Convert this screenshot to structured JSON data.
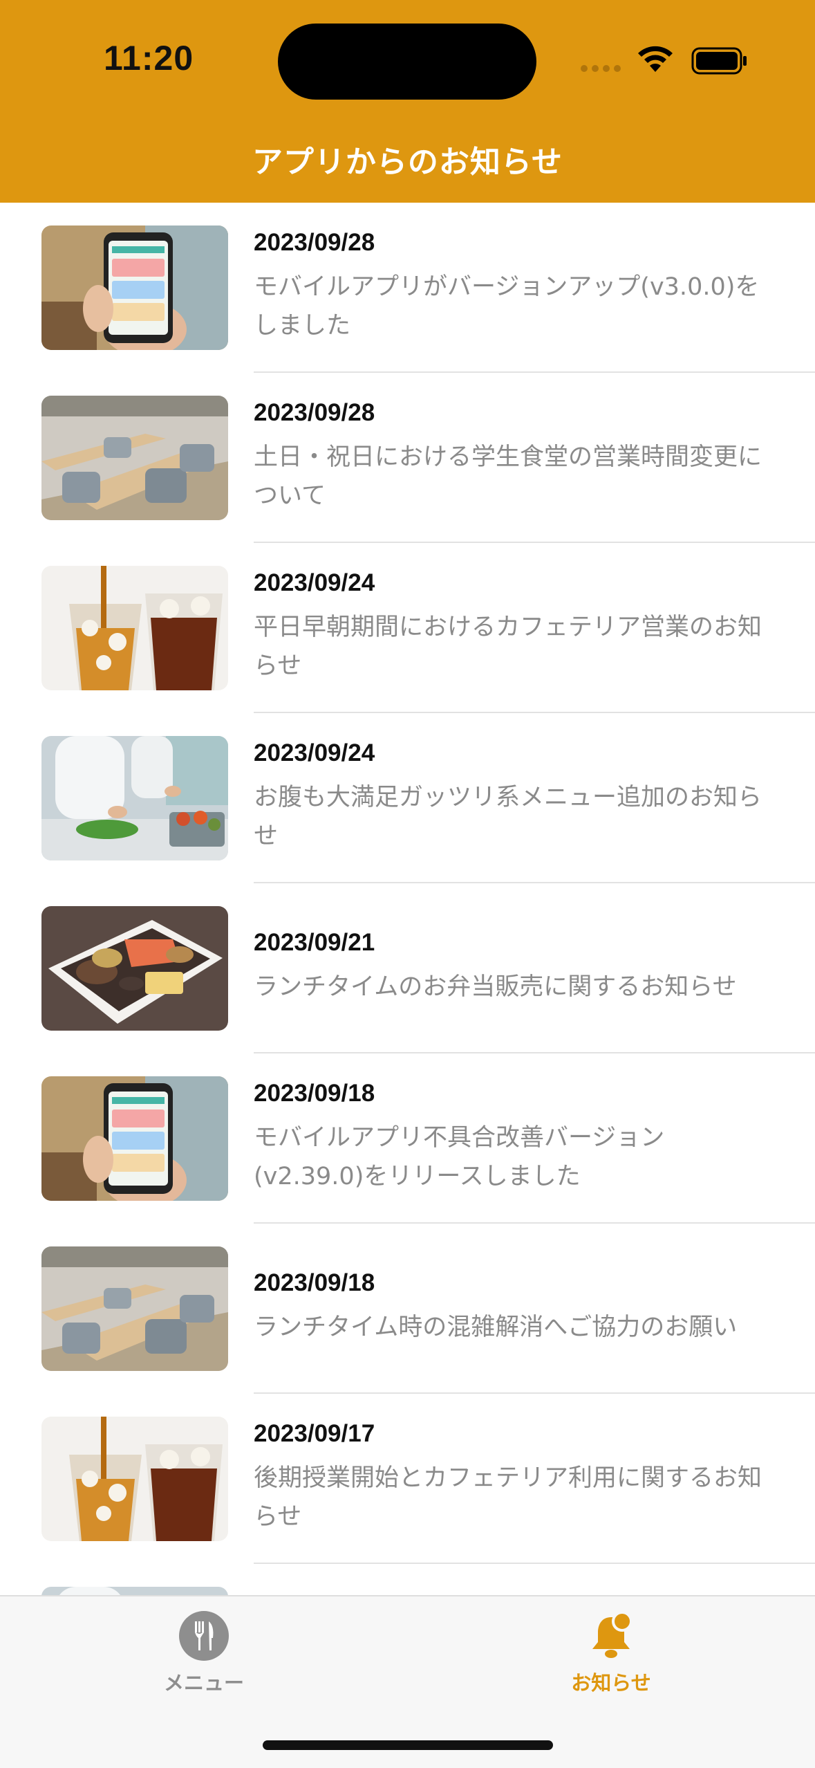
{
  "status_bar": {
    "time": "11:20"
  },
  "header": {
    "title": "アプリからのお知らせ"
  },
  "notices": [
    {
      "date": "2023/09/28",
      "title": "モバイルアプリがバージョンアップ(v3.0.0)をしました",
      "thumb": "phone-order-image"
    },
    {
      "date": "2023/09/28",
      "title": "土日・祝日における学生食堂の営業時間変更について",
      "thumb": "cafeteria-tables-image"
    },
    {
      "date": "2023/09/24",
      "title": "平日早朝期間におけるカフェテリア営業のお知らせ",
      "thumb": "iced-drinks-image"
    },
    {
      "date": "2023/09/24",
      "title": "お腹も大満足ガッツリ系メニュー追加のお知らせ",
      "thumb": "kitchen-cooking-image"
    },
    {
      "date": "2023/09/21",
      "title": "ランチタイムのお弁当販売に関するお知らせ",
      "thumb": "bento-box-image"
    },
    {
      "date": "2023/09/18",
      "title": "モバイルアプリ不具合改善バージョン(v2.39.0)をリリースしました",
      "thumb": "phone-order-image"
    },
    {
      "date": "2023/09/18",
      "title": "ランチタイム時の混雑解消へご協力のお願い",
      "thumb": "cafeteria-tables-image"
    },
    {
      "date": "2023/09/17",
      "title": "後期授業開始とカフェテリア利用に関するお知らせ",
      "thumb": "iced-drinks-image"
    }
  ],
  "tabbar": {
    "menu_label": "メニュー",
    "news_label": "お知らせ",
    "active_tab": "news"
  },
  "colors": {
    "accent": "#DE9710",
    "date_text": "#111111",
    "title_text": "#8A8A8A"
  }
}
